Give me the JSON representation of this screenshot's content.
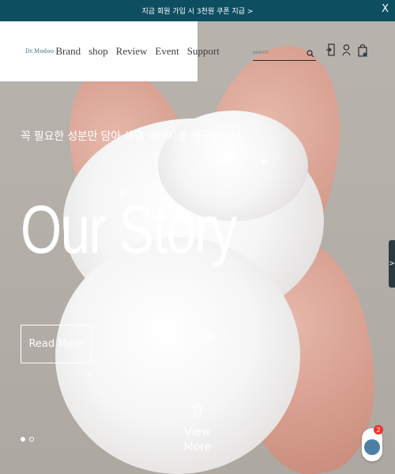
{
  "topbar": {
    "announcement": "지금 회원 가입 시 3천원 쿠폰 지급 >",
    "close_label": "X"
  },
  "brand": {
    "logo_text": "Dr.Modoo",
    "accent_color": "#0d4e61"
  },
  "nav": {
    "items": [
      {
        "label": "Brand"
      },
      {
        "label": "shop"
      },
      {
        "label": "Review"
      },
      {
        "label": "Event"
      },
      {
        "label": "Support"
      }
    ]
  },
  "search": {
    "placeholder": "search",
    "value": ""
  },
  "icons": [
    "search-icon",
    "login-icon",
    "user-icon",
    "cart-icon"
  ],
  "hero": {
    "tagline": "꼭 필요한 성분만 담아 생명 에너지를 연구합니다.",
    "title": "Our Story",
    "read_more_label": "Read More",
    "view_more_label": "View More"
  },
  "slider": {
    "total_slides": 2,
    "active_slide": 1,
    "next_arrow": ">"
  },
  "chat": {
    "badge_count": "2"
  }
}
